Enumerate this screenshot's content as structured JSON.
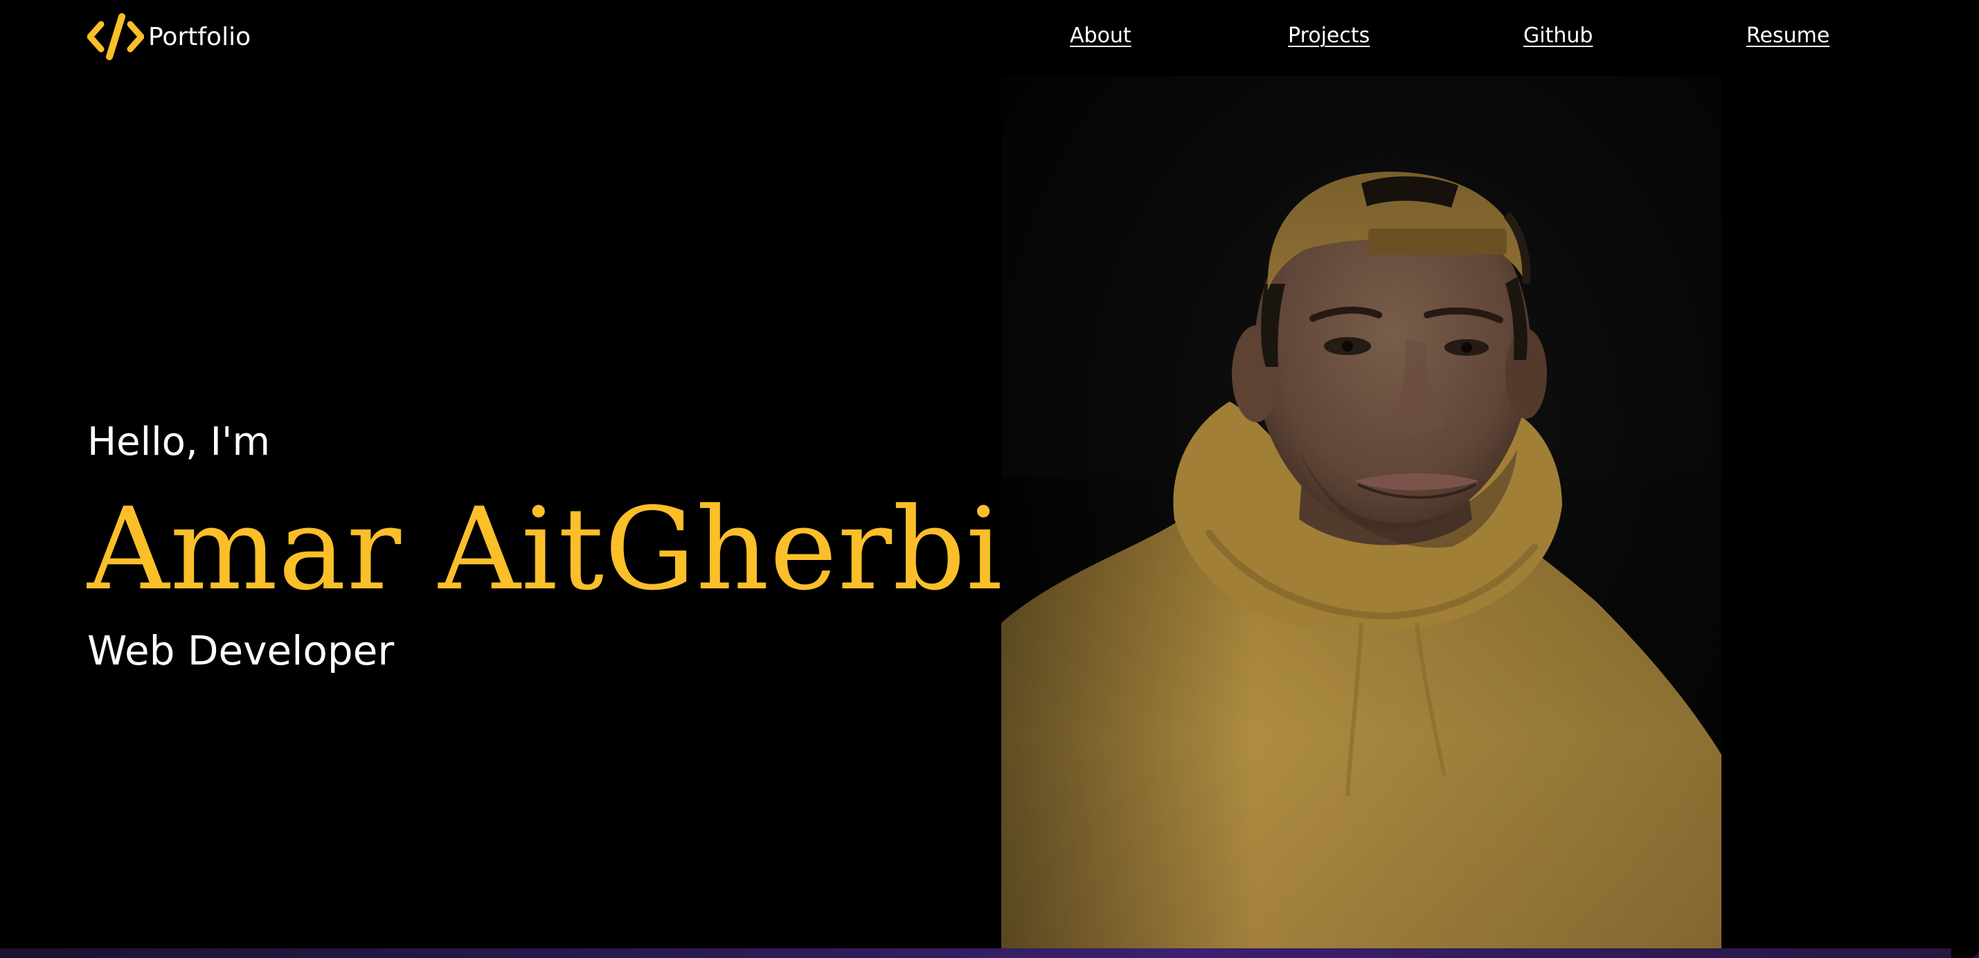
{
  "header": {
    "logo_text": "Portfolio",
    "logo_icon": "code-brackets-icon",
    "nav": [
      {
        "label": "About"
      },
      {
        "label": "Projects"
      },
      {
        "label": "Github"
      },
      {
        "label": "Resume"
      }
    ]
  },
  "hero": {
    "greeting": "Hello, I'm",
    "name": "Amar AitGherbi",
    "role": "Web Developer"
  },
  "colors": {
    "background": "#000000",
    "accent": "#fbbf2a",
    "text": "#ffffff",
    "strip": "#2a1a52"
  }
}
